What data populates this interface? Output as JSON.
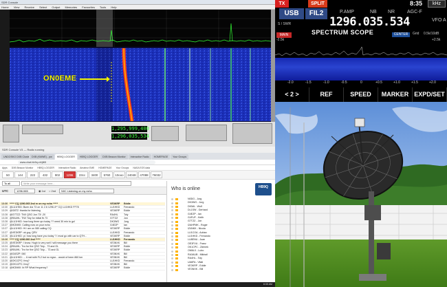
{
  "sdr": {
    "title": "SDR Console",
    "menu": [
      "Home",
      "View",
      "Receive",
      "Select",
      "Output",
      "Memories",
      "Favourites",
      "Tools",
      "Help"
    ],
    "freq_main": "1,295,999,400",
    "freq_sub": "1,296,035,534",
    "callout": "ON0EME",
    "status": "SDR Console V3 — Radio running"
  },
  "radio": {
    "tx_label": "TX",
    "split_label": "SPLIT",
    "mode": "USB",
    "filter": "FIL2",
    "p_amp": "P.AMP",
    "nb": "NB",
    "nr": "NR",
    "agc": "AGC-F",
    "clock": "8:35",
    "khz_label": "kHz",
    "frequency": "1296.035.534",
    "vfo": "VFO A",
    "swr": "S / SWR",
    "main_badge": "MAIN",
    "scope_title": "SPECTRUM SCOPE",
    "center_badge": "CENTER",
    "grid_label": "Grid",
    "span_value": "0.5k/10dB",
    "left_span": "-2.5k",
    "right_span": "+2.5k",
    "axis": [
      "-2.0",
      "-1.5",
      "-1.0",
      "-0.5",
      "0",
      "+0.5",
      "+1.0",
      "+1.5",
      "+2.0"
    ],
    "softkeys": [
      "< 2 >",
      "REF",
      "SPEED",
      "MARKER",
      "EXPD/SET"
    ]
  },
  "browser": {
    "tabs": [
      "UNDOSKO DXB Cluster",
      "DXB (KMWE) - pw",
      "HB9Q LOGGER",
      "HB9Q LOGGER",
      "DXB Beacon Monitor",
      "Interactive Radio",
      "HOMEPAGE",
      "Your Groups"
    ],
    "url": "www.chat.hb9q.ch/jt65",
    "bookmarks": [
      "Apps",
      "DXB Beacon Monitor",
      "HB9Q LOGGER",
      "Interactive Radio",
      "Amateur EME",
      "HOMEPAGE",
      "Your Groups",
      "NASA EOS data"
    ],
    "bands": [
      "50",
      "144",
      "222",
      "432",
      "902",
      "1296",
      "23cc",
      "3400",
      "5760",
      "10ooo",
      "24048",
      "47088",
      "76032"
    ],
    "selected_band": "1296",
    "send_to": "To all",
    "message_placeholder": "Write your message here...",
    "utc_label": "UTC",
    "qrg": "1296.065",
    "radio_1st": "1st",
    "radio_2nd": "2nd",
    "qrg_message": "N0C Listening on my echo",
    "messages": [
      {
        "t": "13:30",
        "x": "***** CQ 1296.065 2nd rx on my echo *****",
        "c": "VE3KRP",
        "n": "Eddie",
        "hl": true
      },
      {
        "t": "13:30",
        "x": "@LU1HKD: Buen día 73 on 11 2.6 1296.4** CQ LU1HKD FF78",
        "c": "LU1HKD",
        "n": "Fernando",
        "hl": false
      },
      {
        "t": "13:29",
        "x": "@G8TZ: thanks for listening",
        "c": "VE3KRP",
        "n": "Eddie",
        "hl": false
      },
      {
        "t": "13:28",
        "x": "@G7TZZ: TNX QSO Jun 73! -20",
        "c": "RA4HL",
        "n": "Toly",
        "hl": false
      },
      {
        "t": "13:28",
        "x": "@RA4HL: TNX Toly for initial fb 73",
        "c": "G7TZZ",
        "n": "Jon",
        "hl": false
      },
      {
        "t": "13:28",
        "x": "@LU1HKD: how long three qrv today ?? need 30 min to go!",
        "c": "DK3WG",
        "n": "Jurg",
        "hl": false
      },
      {
        "t": "13:27",
        "x": "@IK3NKK: Calling now on your echo",
        "c": "G4EZP",
        "n": "Ian",
        "hl": false
      },
      {
        "t": "13:27",
        "x": "@LU1HKD: Hi i am on 080 calling CQ",
        "c": "VE3KRP",
        "n": "Eddie",
        "hl": false
      },
      {
        "t": "13:27",
        "x": "@VE3KRP: ok guy, QRV",
        "c": "LU1HKD",
        "n": "Fernando",
        "hl": false
      },
      {
        "t": "13:26",
        "x": "@LU1HKD: pl. how long have you today ? I must go with car to QTH...",
        "c": "VE3KRP",
        "n": "Eddie",
        "hl": false
      },
      {
        "t": "13:26",
        "x": "***** CQ 1296.060 2nd *****",
        "c": "LU1HKD",
        "n": "Fernando",
        "hl": true
      },
      {
        "t": "13:25",
        "x": "@VE3KRP: I know. Hugh to very well I will message you there",
        "c": "VE3NXK",
        "n": "Bill",
        "hl": false
      },
      {
        "t": "13:24",
        "x": "@RA4HL: Tnx for the QSO Toly... 73 and GL",
        "c": "VE3KRP",
        "n": "Eddie",
        "hl": false
      },
      {
        "t": "13:23",
        "x": "@RA4HL: Tnx for the QSO Toly.... 73 and GL",
        "c": "VE3KRP",
        "n": "Eddie",
        "hl": false
      },
      {
        "t": "13:22",
        "x": "@G4EZP: 060",
        "c": "VE3NXK",
        "n": "Bill",
        "hl": false
      },
      {
        "t": "13:21",
        "x": "@LU1HKD: ... ti mel with FL2 but no rrgwr... would of been 860 km",
        "c": "VE3NXK",
        "n": "Bill",
        "hl": false
      },
      {
        "t": "13:20",
        "x": "@OK1CPC: freq?",
        "c": "LU1HKD",
        "n": "Fernando",
        "hl": false
      },
      {
        "t": "13:19",
        "x": "@OK1CPC: freq?",
        "c": "VE3NXK",
        "n": "Bill",
        "hl": false
      },
      {
        "t": "13:18",
        "x": "@IK3NKK: ib RP What frequency?",
        "c": "VE3KRP",
        "n": "Eddie",
        "hl": false
      }
    ],
    "who_title": "Who is online",
    "hb9q_logo": "HB9Q",
    "who": [
      "N0DG - Jurg",
      "DK3WG - Jurg",
      "DK5AI - Wolf",
      "DL1SW - Gerhard",
      "G4EZP - Ian",
      "G4FUF - Keith",
      "G7TZZ - Jon",
      "I2AHPMK - Roger",
      "IZ4NKK - Nicola",
      "LU1COA - Adrian",
      "LU1HKD - Fernando",
      "LU8ENU - Juan",
      "OE3FVU - Franz",
      "OK1CPC - Zdenek",
      "OM6LX - Lubo",
      "RA3AUB - Mikhail",
      "RA4HL - Toly",
      "UA6FA - Vitali",
      "VE3KRP - Eddie",
      "VE3NXK - Bill"
    ],
    "task_clock": "8:35 AM"
  },
  "colors": {
    "radio_red": "#d82020",
    "radio_blue": "#2f4a86",
    "callout_yellow": "#f4f400",
    "band_selected": "#d73a3a",
    "signal_red": "#e62626",
    "signal_green": "#33ff33"
  }
}
